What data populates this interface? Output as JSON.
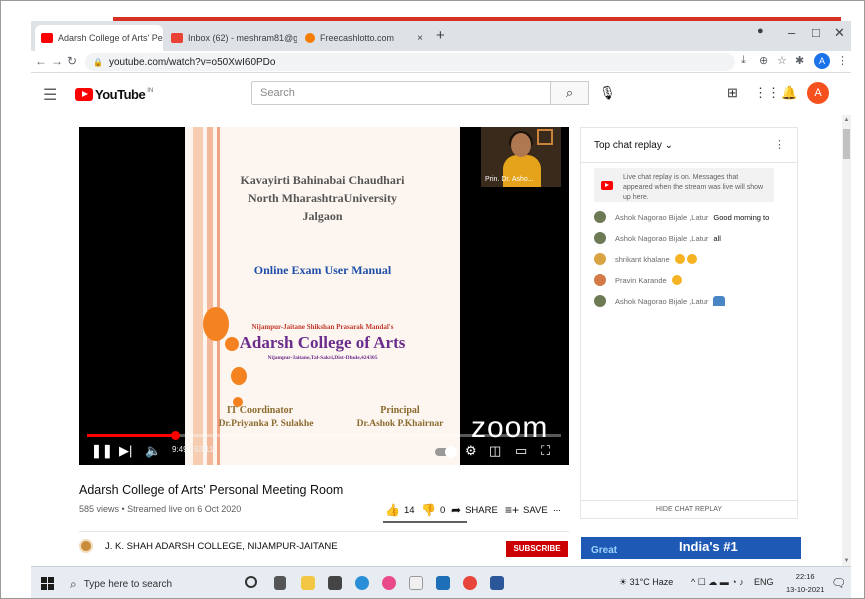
{
  "browser": {
    "tabs": [
      {
        "label": "Adarsh College of Arts' Perso",
        "favicon_color": "#ff0000",
        "active": true,
        "audio": true
      },
      {
        "label": "Inbox (62) - meshram81@gmail.",
        "favicon_color": "#ea4335",
        "active": false
      },
      {
        "label": "Freecashlotto.com",
        "favicon_color": "#f57c00",
        "active": false
      }
    ],
    "close_glyph": "×",
    "new_tab_glyph": "+",
    "url": "youtube.com/watch?v=o50XwI60PDo",
    "profile_initial": "A",
    "window_controls": {
      "minimize": "–",
      "maximize": "□",
      "close": "✕"
    }
  },
  "youtube": {
    "logo_text": "YouTube",
    "country_code": "IN",
    "search_placeholder": "Search",
    "avatar_initial": "A"
  },
  "video": {
    "slide": {
      "org_line1": "Kavayirti Bahinabai Chaudhari",
      "org_line2": "North MharashtraUniversity",
      "org_line3": "Jalgaon",
      "manual": "Online Exam User Manual",
      "society": "Nijampur-Jaitane Shikshan Prasarak Mandal's",
      "college": "Adarsh College of Arts",
      "address": "Nijampur-Jaitane,Tal-Sakri,Dist-Dhule,424305",
      "role_left": "IT Coordinator",
      "name_left": "Dr.Priyanka P. Sulakhe",
      "role_right": "Principal",
      "name_right": "Dr.Ashok P.Khairnar"
    },
    "pip_name": "Prin. Dr. Asho...",
    "watermark": "zoom",
    "current_time": "9:49",
    "duration": "53:11",
    "progress_fraction": 0.185,
    "title": "Adarsh College of Arts' Personal Meeting Room",
    "meta": "585 views • Streamed live on 6 Oct 2020",
    "likes": "14",
    "dislikes": "0",
    "share_label": "SHARE",
    "save_label": "SAVE",
    "more_label": "...",
    "channel": "J. K. SHAH ADARSH COLLEGE, NIJAMPUR-JAITANE",
    "subscribe_label": "SUBSCRIBE"
  },
  "chat": {
    "title": "Top chat replay",
    "banner": "Live chat replay is on. Messages that appeared when the stream was live will show up here.",
    "messages": [
      {
        "author": "Ashok Nagorao Bijale ,Latur",
        "text": "Good morning to",
        "avatar_color": "#6d7a55"
      },
      {
        "author": "Ashok Nagorao Bijale ,Latur",
        "text": "all",
        "avatar_color": "#6d7a55"
      },
      {
        "author": "shrikant khalane",
        "text": "",
        "avatar_color": "#d9a343",
        "emoji": "clap-clap"
      },
      {
        "author": "Pravin Karande",
        "text": "",
        "avatar_color": "#d27b46",
        "emoji": "clap"
      },
      {
        "author": "Ashok Nagorao Bijale ,Latur",
        "text": "",
        "avatar_color": "#6d7a55",
        "emoji": "pray"
      }
    ],
    "hide_label": "HIDE CHAT REPLAY"
  },
  "ad": {
    "headline": "India's #1",
    "left_text": "Great"
  },
  "taskbar": {
    "search_placeholder": "Type here to search",
    "weather": "31°C Haze",
    "lang": "ENG",
    "time": "22:16",
    "date": "13-10-2021"
  }
}
